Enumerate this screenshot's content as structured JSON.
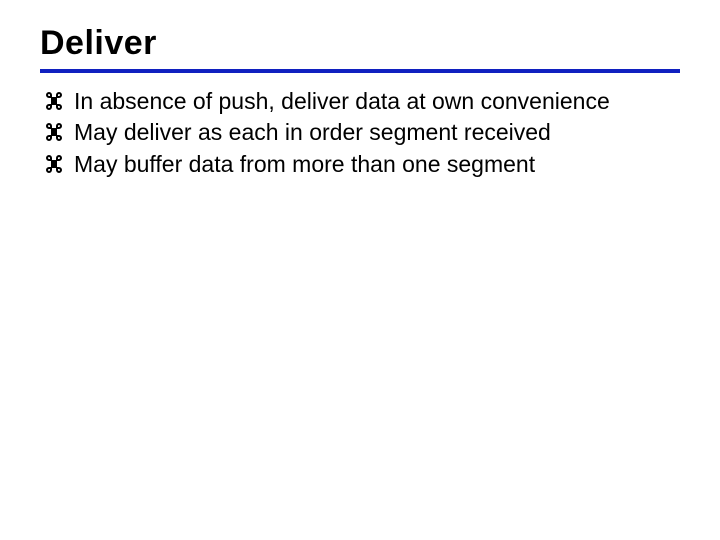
{
  "slide": {
    "title": "Deliver",
    "bullets": [
      "In absence of push, deliver data at own convenience",
      "May deliver as each in order segment received",
      "May buffer data from more than one segment"
    ]
  }
}
